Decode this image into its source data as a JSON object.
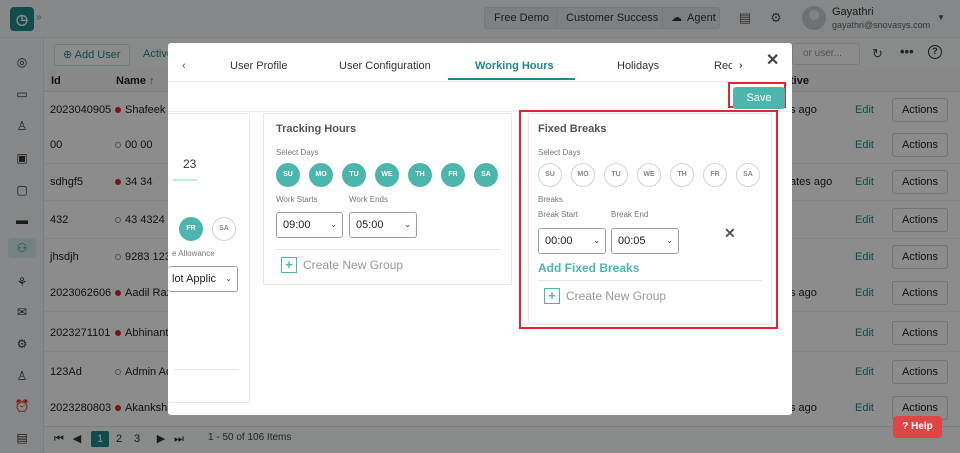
{
  "topbar": {
    "free_demo": "Free Demo",
    "customer_success": "Customer Success",
    "agent": "Agent",
    "user_name": "Gayathri",
    "user_email": "gayathri@snovasys.com"
  },
  "toolbar": {
    "add_user": "Add User",
    "active_tab": "Active",
    "search_placeholder": "or user..."
  },
  "table": {
    "headers": {
      "id": "Id",
      "name": "Name",
      "active": "tive"
    },
    "rows": [
      {
        "id": "2023040905",
        "name": "Shafeek S",
        "ago": "s ago",
        "edit": "Edit",
        "actions": "Actions",
        "dot": "red"
      },
      {
        "id": "00",
        "name": "00 00",
        "ago": "",
        "edit": "Edit",
        "actions": "Actions",
        "dot": "grey"
      },
      {
        "id": "sdhgf5",
        "name": "34 34",
        "ago": "ates ago",
        "edit": "Edit",
        "actions": "Actions",
        "dot": "red"
      },
      {
        "id": "432",
        "name": "43 4324",
        "ago": "",
        "edit": "Edit",
        "actions": "Actions",
        "dot": "grey"
      },
      {
        "id": "jhsdjh",
        "name": "9283 123",
        "ago": "",
        "edit": "Edit",
        "actions": "Actions",
        "dot": "grey"
      },
      {
        "id": "2023062606",
        "name": "Aadil Raz",
        "ago": "s ago",
        "edit": "Edit",
        "actions": "Actions",
        "dot": "red"
      },
      {
        "id": "2023271101",
        "name": "Abhinanth",
        "ago": "",
        "edit": "Edit",
        "actions": "Actions",
        "dot": "red"
      },
      {
        "id": "123Ad",
        "name": "Admin Ad",
        "ago": "",
        "edit": "Edit",
        "actions": "Actions",
        "dot": "grey"
      },
      {
        "id": "2023280803",
        "name": "Akanksha",
        "ago": "s ago",
        "edit": "Edit",
        "actions": "Actions",
        "dot": "red"
      }
    ]
  },
  "pager": {
    "pages": [
      "1",
      "2",
      "3"
    ],
    "current": "1",
    "summary": "1 - 50 of 106 Items"
  },
  "modal": {
    "tabs": [
      "User Profile",
      "User Configuration",
      "Working Hours",
      "Holidays",
      "Rec"
    ],
    "active_tab": "Working Hours",
    "save": "Save",
    "left_panel": {
      "value_23": "23",
      "day_fr": "FR",
      "day_sa": "SA",
      "allowance_label": "e Allowance",
      "allowance_value": "lot Applic"
    },
    "tracking": {
      "title": "Tracking Hours",
      "select_days": "Select Days",
      "days": [
        "SU",
        "MO",
        "TU",
        "WE",
        "TH",
        "FR",
        "SA"
      ],
      "work_starts_label": "Work Starts",
      "work_ends_label": "Work Ends",
      "work_starts": "09:00",
      "work_ends": "05:00",
      "create_group": "Create New Group"
    },
    "fixed_breaks": {
      "title": "Fixed Breaks",
      "select_days": "Select Days",
      "days": [
        "SU",
        "MO",
        "TU",
        "WE",
        "TH",
        "FR",
        "SA"
      ],
      "breaks_label": "Breaks",
      "break_start_label": "Break Start",
      "break_end_label": "Break End",
      "break_start": "00:00",
      "break_end": "00:05",
      "add_fixed_breaks": "Add Fixed Breaks",
      "create_group": "Create New Group"
    }
  },
  "help": "Help",
  "colors": {
    "accent": "#1f8a8a",
    "teal_light": "#4db6ac",
    "highlight_red": "#e0262f",
    "help_red": "#e04545"
  }
}
